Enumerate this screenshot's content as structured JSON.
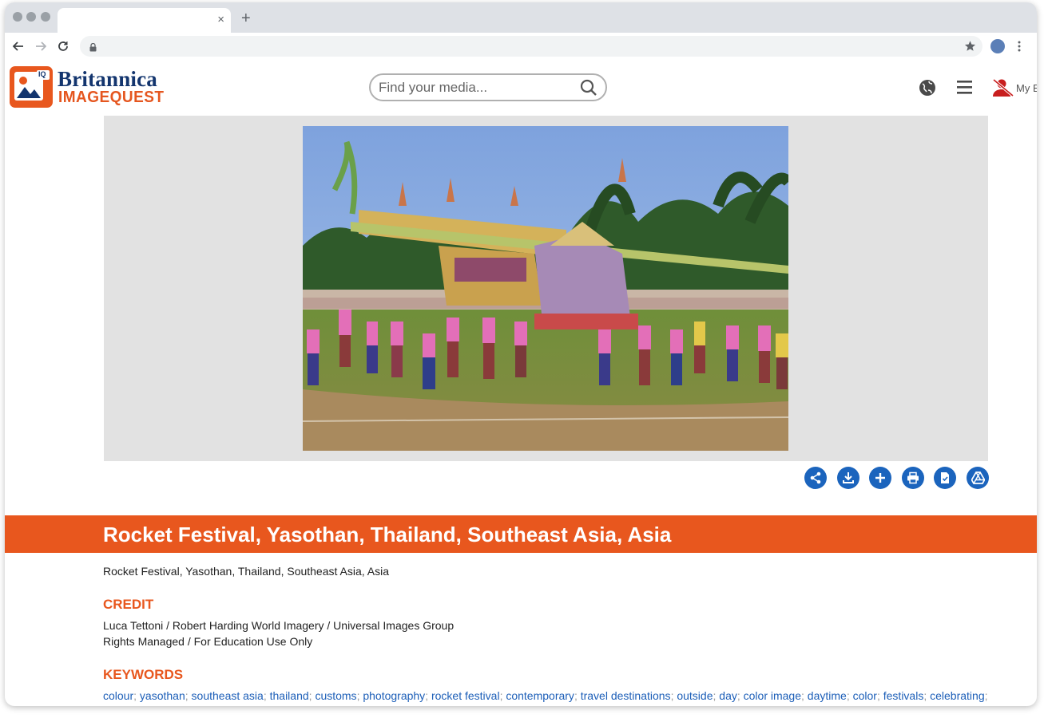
{
  "browser": {
    "tab_title": "",
    "tab_close": "×",
    "new_tab": "+",
    "address": ""
  },
  "header": {
    "brand_line1": "Britannica",
    "brand_line2": "IMAGEQUEST",
    "logo_badge": "IQ",
    "search_placeholder": "Find your media...",
    "account_label": "My B",
    "icons": [
      "globe-icon",
      "hamburger-menu-icon",
      "user-signed-out-icon",
      "search-icon"
    ]
  },
  "actions": [
    {
      "name": "share-button",
      "icon": "share-icon"
    },
    {
      "name": "download-button",
      "icon": "download-icon"
    },
    {
      "name": "add-button",
      "icon": "plus-icon"
    },
    {
      "name": "print-button",
      "icon": "printer-icon"
    },
    {
      "name": "cite-button",
      "icon": "document-check-icon"
    },
    {
      "name": "google-drive-button",
      "icon": "google-drive-icon"
    }
  ],
  "image": {
    "title": "Rocket Festival, Yasothan, Thailand, Southeast Asia, Asia",
    "caption": "Rocket Festival, Yasothan, Thailand, Southeast Asia, Asia"
  },
  "credit": {
    "heading": "CREDIT",
    "line1": "Luca Tettoni / Robert Harding World Imagery / Universal Images Group",
    "line2": "Rights Managed / For Education Use Only"
  },
  "keywords": {
    "heading": "KEYWORDS",
    "items": [
      "colour",
      "yasothan",
      "southeast asia",
      "thailand",
      "customs",
      "photography",
      "rocket festival",
      "contemporary",
      "travel destinations",
      "outside",
      "day",
      "color image",
      "daytime",
      "color",
      "festivals",
      "celebrating"
    ]
  },
  "colors": {
    "accent": "#e8571e",
    "brand_navy": "#13356e",
    "action_blue": "#1b64bd",
    "link": "#1d5fb8"
  }
}
